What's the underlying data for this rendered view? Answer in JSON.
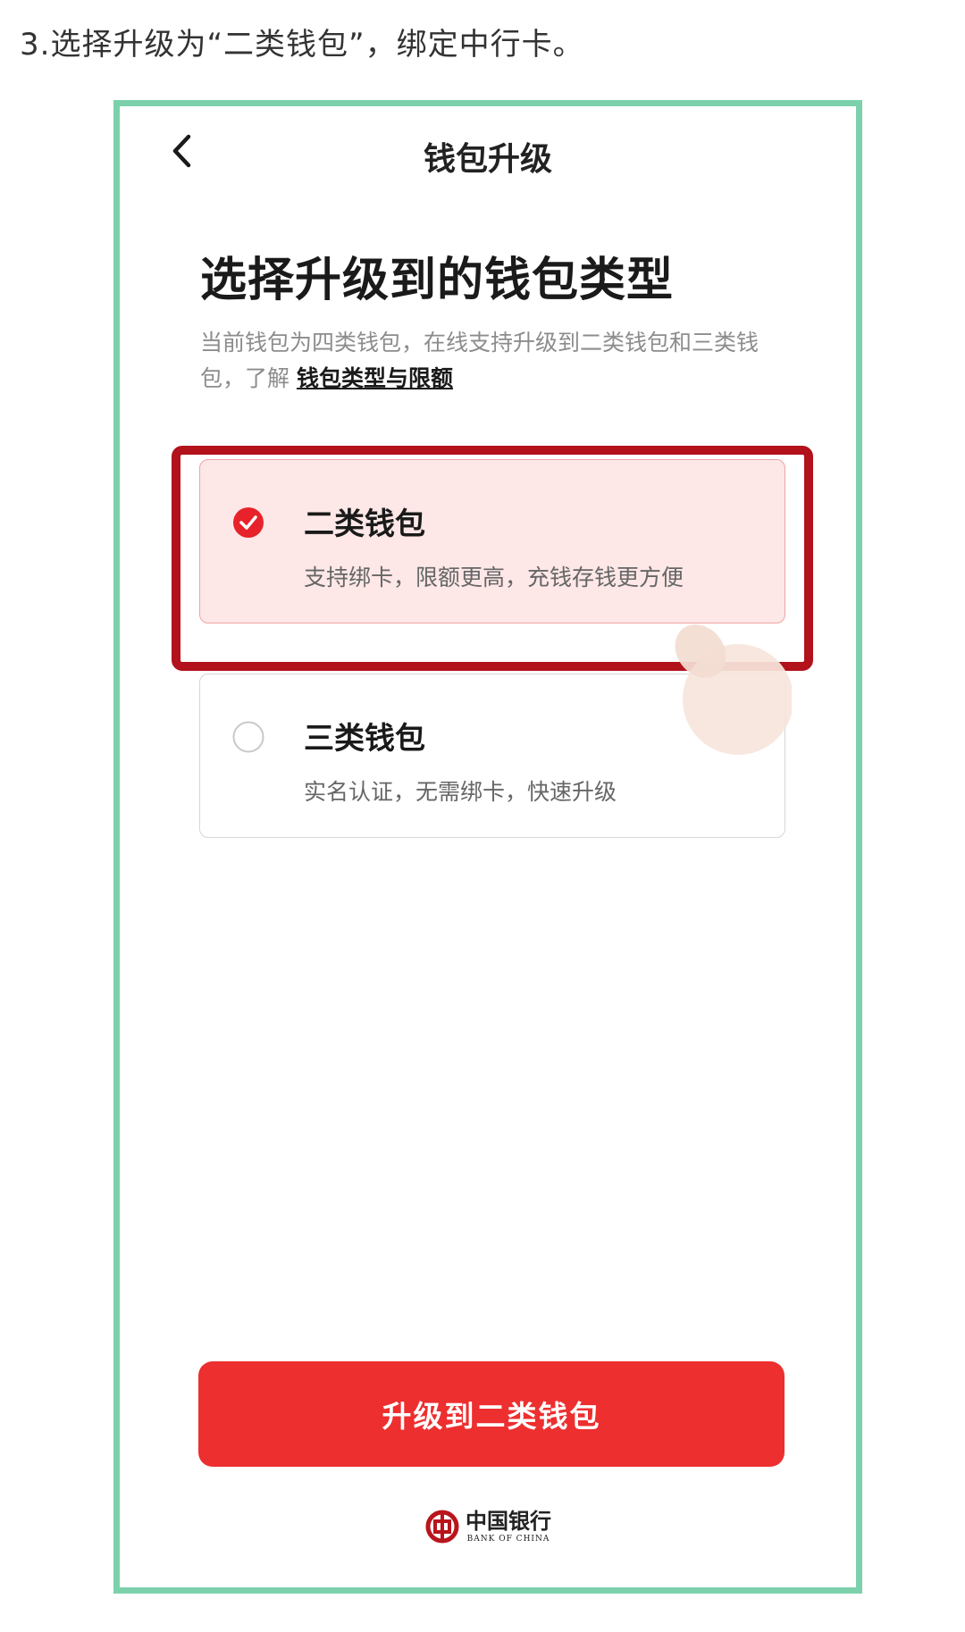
{
  "step_caption": "3.选择升级为“二类钱包”，绑定中行卡。",
  "header": {
    "title": "钱包升级",
    "back_icon": "chevron-left-icon"
  },
  "main": {
    "heading": "选择升级到的钱包类型",
    "description_prefix": "当前钱包为四类钱包，在线支持升级到二类钱包和三类钱包，了解 ",
    "description_link": "钱包类型与限额"
  },
  "options": [
    {
      "title": "二类钱包",
      "subtitle": "支持绑卡，限额更高，充钱存钱更方便",
      "selected": true
    },
    {
      "title": "三类钱包",
      "subtitle": "实名认证，无需绑卡，快速升级",
      "selected": false
    }
  ],
  "primary_button": "升级到二类钱包",
  "logo": {
    "name_cn": "中国银行",
    "name_en": "BANK OF CHINA"
  },
  "colors": {
    "accent": "#ed2f2f",
    "highlight_border": "#b1121b",
    "frame_border": "#7cd1ac",
    "selected_card_bg": "#fde7e7"
  }
}
